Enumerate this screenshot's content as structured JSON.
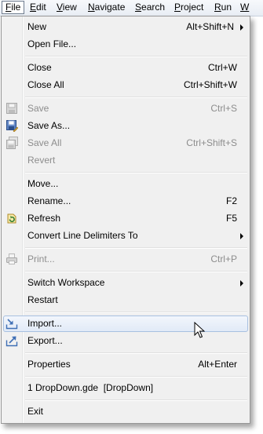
{
  "menubar": {
    "items": [
      {
        "mnemonic": "F",
        "rest": "ile"
      },
      {
        "mnemonic": "E",
        "rest": "dit"
      },
      {
        "mnemonic": "V",
        "rest": "iew"
      },
      {
        "mnemonic": "N",
        "rest": "avigate"
      },
      {
        "mnemonic": "S",
        "rest": "earch"
      },
      {
        "mnemonic": "P",
        "rest": "roject"
      },
      {
        "mnemonic": "R",
        "rest": "un"
      },
      {
        "mnemonic": "W",
        "rest": ""
      }
    ]
  },
  "file_menu": {
    "items": [
      {
        "label": "New",
        "accel": "Alt+Shift+N"
      },
      {
        "label": "Open File..."
      },
      {
        "label": "Close",
        "accel": "Ctrl+W"
      },
      {
        "label": "Close All",
        "accel": "Ctrl+Shift+W"
      },
      {
        "label": "Save",
        "accel": "Ctrl+S"
      },
      {
        "label": "Save As..."
      },
      {
        "label": "Save All",
        "accel": "Ctrl+Shift+S"
      },
      {
        "label": "Revert"
      },
      {
        "label": "Move..."
      },
      {
        "label": "Rename...",
        "accel": "F2"
      },
      {
        "label": "Refresh",
        "accel": "F5"
      },
      {
        "label": "Convert Line Delimiters To"
      },
      {
        "label": "Print...",
        "accel": "Ctrl+P"
      },
      {
        "label": "Switch Workspace"
      },
      {
        "label": "Restart"
      },
      {
        "label": "Import..."
      },
      {
        "label": "Export..."
      },
      {
        "label": "Properties",
        "accel": "Alt+Enter"
      },
      {
        "label": "1 DropDown.gde  [DropDown]"
      },
      {
        "label": "Exit"
      }
    ]
  },
  "icons": {
    "save": "save-disk-icon",
    "save_as": "save-as-icon",
    "save_all": "save-all-icon",
    "refresh": "refresh-icon",
    "print": "print-icon",
    "import": "import-icon",
    "export": "export-icon",
    "cursor": "mouse-pointer-icon"
  },
  "colors": {
    "menu_background": "#f0f0f0",
    "hover_border": "#a8c0e0",
    "disabled_text": "#8d8d8d",
    "icon_blue": "#3f6fb5"
  }
}
